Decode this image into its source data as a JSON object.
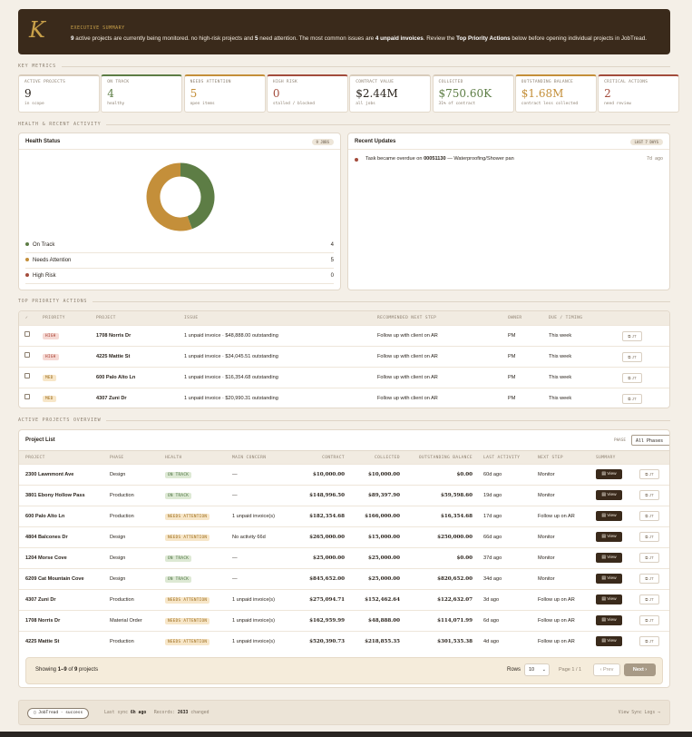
{
  "exec": {
    "label": "EXECUTIVE SUMMARY",
    "k": "K",
    "parts": [
      [
        "9",
        true
      ],
      [
        " active projects are currently being monitored. no high-risk projects and ",
        false
      ],
      [
        "5",
        true
      ],
      [
        " need attention. The most common issues are ",
        false
      ],
      [
        "4 unpaid invoices",
        true
      ],
      [
        ". Review the ",
        false
      ],
      [
        "Top Priority Actions",
        true
      ],
      [
        " below before opening individual projects in JobTread.",
        false
      ]
    ]
  },
  "sections": {
    "metrics": "KEY METRICS",
    "health": "HEALTH & RECENT ACTIVITY",
    "priority": "TOP PRIORITY ACTIONS",
    "overview": "ACTIVE PROJECTS OVERVIEW"
  },
  "metrics": [
    {
      "label": "ACTIVE PROJECTS",
      "value": "9",
      "sub": "in scope",
      "color": "#2b241d",
      "top": "#d8ccbb"
    },
    {
      "label": "ON TRACK",
      "value": "4",
      "sub": "healthy",
      "color": "#5d7d45",
      "top": "#5d7d45"
    },
    {
      "label": "NEEDS ATTENTION",
      "value": "5",
      "sub": "open items",
      "color": "#c48f3a",
      "top": "#c48f3a"
    },
    {
      "label": "HIGH RISK",
      "value": "0",
      "sub": "stalled / blocked",
      "color": "#a34c3c",
      "top": "#a34c3c"
    },
    {
      "label": "CONTRACT VALUE",
      "value": "$2.44M",
      "sub": "all jobs",
      "color": "#2b241d",
      "top": "#d8ccbb"
    },
    {
      "label": "COLLECTED",
      "value": "$750.60K",
      "sub": "31% of contract",
      "color": "#5d7d45",
      "top": "#d8ccbb"
    },
    {
      "label": "OUTSTANDING BALANCE",
      "value": "$1.68M",
      "sub": "contract less collected",
      "color": "#c48f3a",
      "top": "#c48f3a"
    },
    {
      "label": "CRITICAL ACTIONS",
      "value": "2",
      "sub": "need review",
      "color": "#a34c3c",
      "top": "#a34c3c"
    }
  ],
  "health": {
    "title": "Health Status",
    "pill": "9 JOBS",
    "items": [
      {
        "label": "On Track",
        "count": "4",
        "color": "#5d7d45",
        "value": 4
      },
      {
        "label": "Needs Attention",
        "count": "5",
        "color": "#c48f3a",
        "value": 5
      },
      {
        "label": "High Risk",
        "count": "0",
        "color": "#a34c3c",
        "value": 0
      }
    ]
  },
  "updates": {
    "title": "Recent Updates",
    "pill": "LAST 7 DAYS",
    "items": [
      {
        "pre": "Task became overdue on ",
        "job": "00051130",
        "post": " — Waterproofing/Shower pan",
        "time": "7d ago"
      }
    ]
  },
  "priority": {
    "headers": [
      "✓",
      "PRIORITY",
      "PROJECT",
      "ISSUE",
      "RECOMMENDED NEXT STEP",
      "OWNER",
      "DUE / TIMING"
    ],
    "rows": [
      {
        "priority": "HIGH",
        "project": "1708 Norris Dr",
        "issue": "1 unpaid invoice · $48,888.00 outstanding",
        "step": "Follow up with client on AR",
        "owner": "PM",
        "due": "This week",
        "jt": "⧉ JT"
      },
      {
        "priority": "HIGH",
        "project": "4225 Mattie St",
        "issue": "1 unpaid invoice · $34,045.51 outstanding",
        "step": "Follow up with client on AR",
        "owner": "PM",
        "due": "This week",
        "jt": "⧉ JT"
      },
      {
        "priority": "MED",
        "project": "600 Palo Alto Ln",
        "issue": "1 unpaid invoice · $16,354.68 outstanding",
        "step": "Follow up with client on AR",
        "owner": "PM",
        "due": "This week",
        "jt": "⧉ JT"
      },
      {
        "priority": "MED",
        "project": "4307 Zuni Dr",
        "issue": "1 unpaid invoice · $20,990.31 outstanding",
        "step": "Follow up with client on AR",
        "owner": "PM",
        "due": "This week",
        "jt": "⧉ JT"
      }
    ]
  },
  "projects": {
    "title": "Project List",
    "phase_label": "PHASE",
    "phase_value": "All Phases",
    "headers": [
      "PROJECT",
      "PHASE",
      "HEALTH",
      "MAIN CONCERN",
      "CONTRACT",
      "COLLECTED",
      "OUTSTANDING BALANCE",
      "LAST ACTIVITY",
      "NEXT STEP",
      "SUMMARY"
    ],
    "view_label": "▤ View",
    "jt_label": "⧉ JT",
    "rows": [
      {
        "project": "2300 Lawnmont Ave",
        "phase": "Design",
        "health": "ON TRACK",
        "concern": "—",
        "contract": "$10,000.00",
        "collected": "$10,000.00",
        "outstanding": "$0.00",
        "activity": "60d ago",
        "next": "Monitor"
      },
      {
        "project": "3801 Ebony Hollow Pass",
        "phase": "Production",
        "health": "ON TRACK",
        "concern": "—",
        "contract": "$148,996.50",
        "collected": "$89,397.90",
        "outstanding": "$59,598.60",
        "activity": "19d ago",
        "next": "Monitor"
      },
      {
        "project": "600 Palo Alto Ln",
        "phase": "Production",
        "health": "NEEDS ATTENTION",
        "concern": "1 unpaid invoice(s)",
        "contract": "$182,354.68",
        "collected": "$166,000.00",
        "outstanding": "$16,354.68",
        "activity": "17d ago",
        "next": "Follow up on AR"
      },
      {
        "project": "4804 Balcones Dr",
        "phase": "Design",
        "health": "NEEDS ATTENTION",
        "concern": "No activity 66d",
        "contract": "$265,000.00",
        "collected": "$15,000.00",
        "outstanding": "$250,000.00",
        "activity": "66d ago",
        "next": "Monitor"
      },
      {
        "project": "1204 Morse Cove",
        "phase": "Design",
        "health": "ON TRACK",
        "concern": "—",
        "contract": "$25,000.00",
        "collected": "$25,000.00",
        "outstanding": "$0.00",
        "activity": "37d ago",
        "next": "Monitor"
      },
      {
        "project": "6209 Cat Mountain Cove",
        "phase": "Design",
        "health": "ON TRACK",
        "concern": "—",
        "contract": "$845,652.00",
        "collected": "$25,000.00",
        "outstanding": "$820,652.00",
        "activity": "34d ago",
        "next": "Monitor"
      },
      {
        "project": "4307 Zuni Dr",
        "phase": "Production",
        "health": "NEEDS ATTENTION",
        "concern": "1 unpaid invoice(s)",
        "contract": "$275,094.71",
        "collected": "$152,462.64",
        "outstanding": "$122,632.07",
        "activity": "3d ago",
        "next": "Follow up on AR"
      },
      {
        "project": "1708 Norris Dr",
        "phase": "Material Order",
        "health": "NEEDS ATTENTION",
        "concern": "1 unpaid invoice(s)",
        "contract": "$162,959.99",
        "collected": "$48,888.00",
        "outstanding": "$114,071.99",
        "activity": "6d ago",
        "next": "Follow up on AR"
      },
      {
        "project": "4225 Mattie St",
        "phase": "Production",
        "health": "NEEDS ATTENTION",
        "concern": "1 unpaid invoice(s)",
        "contract": "$520,390.73",
        "collected": "$218,855.35",
        "outstanding": "$301,535.38",
        "activity": "4d ago",
        "next": "Follow up on AR"
      }
    ]
  },
  "pagination": {
    "pre": "Showing ",
    "range": "1–9",
    "mid": " of ",
    "total": "9",
    "post": " projects",
    "rows_label": "Rows",
    "rows_value": "10",
    "page": "Page 1 / 1",
    "prev": "‹ Prev",
    "next": "Next ›"
  },
  "footer": {
    "source": "▢ JobTread · success",
    "sync_label": "Last sync",
    "sync_value": "6h ago",
    "records_label": "Records:",
    "records_value": "2633",
    "records_post": "changed",
    "logs": "View Sync Logs →"
  }
}
